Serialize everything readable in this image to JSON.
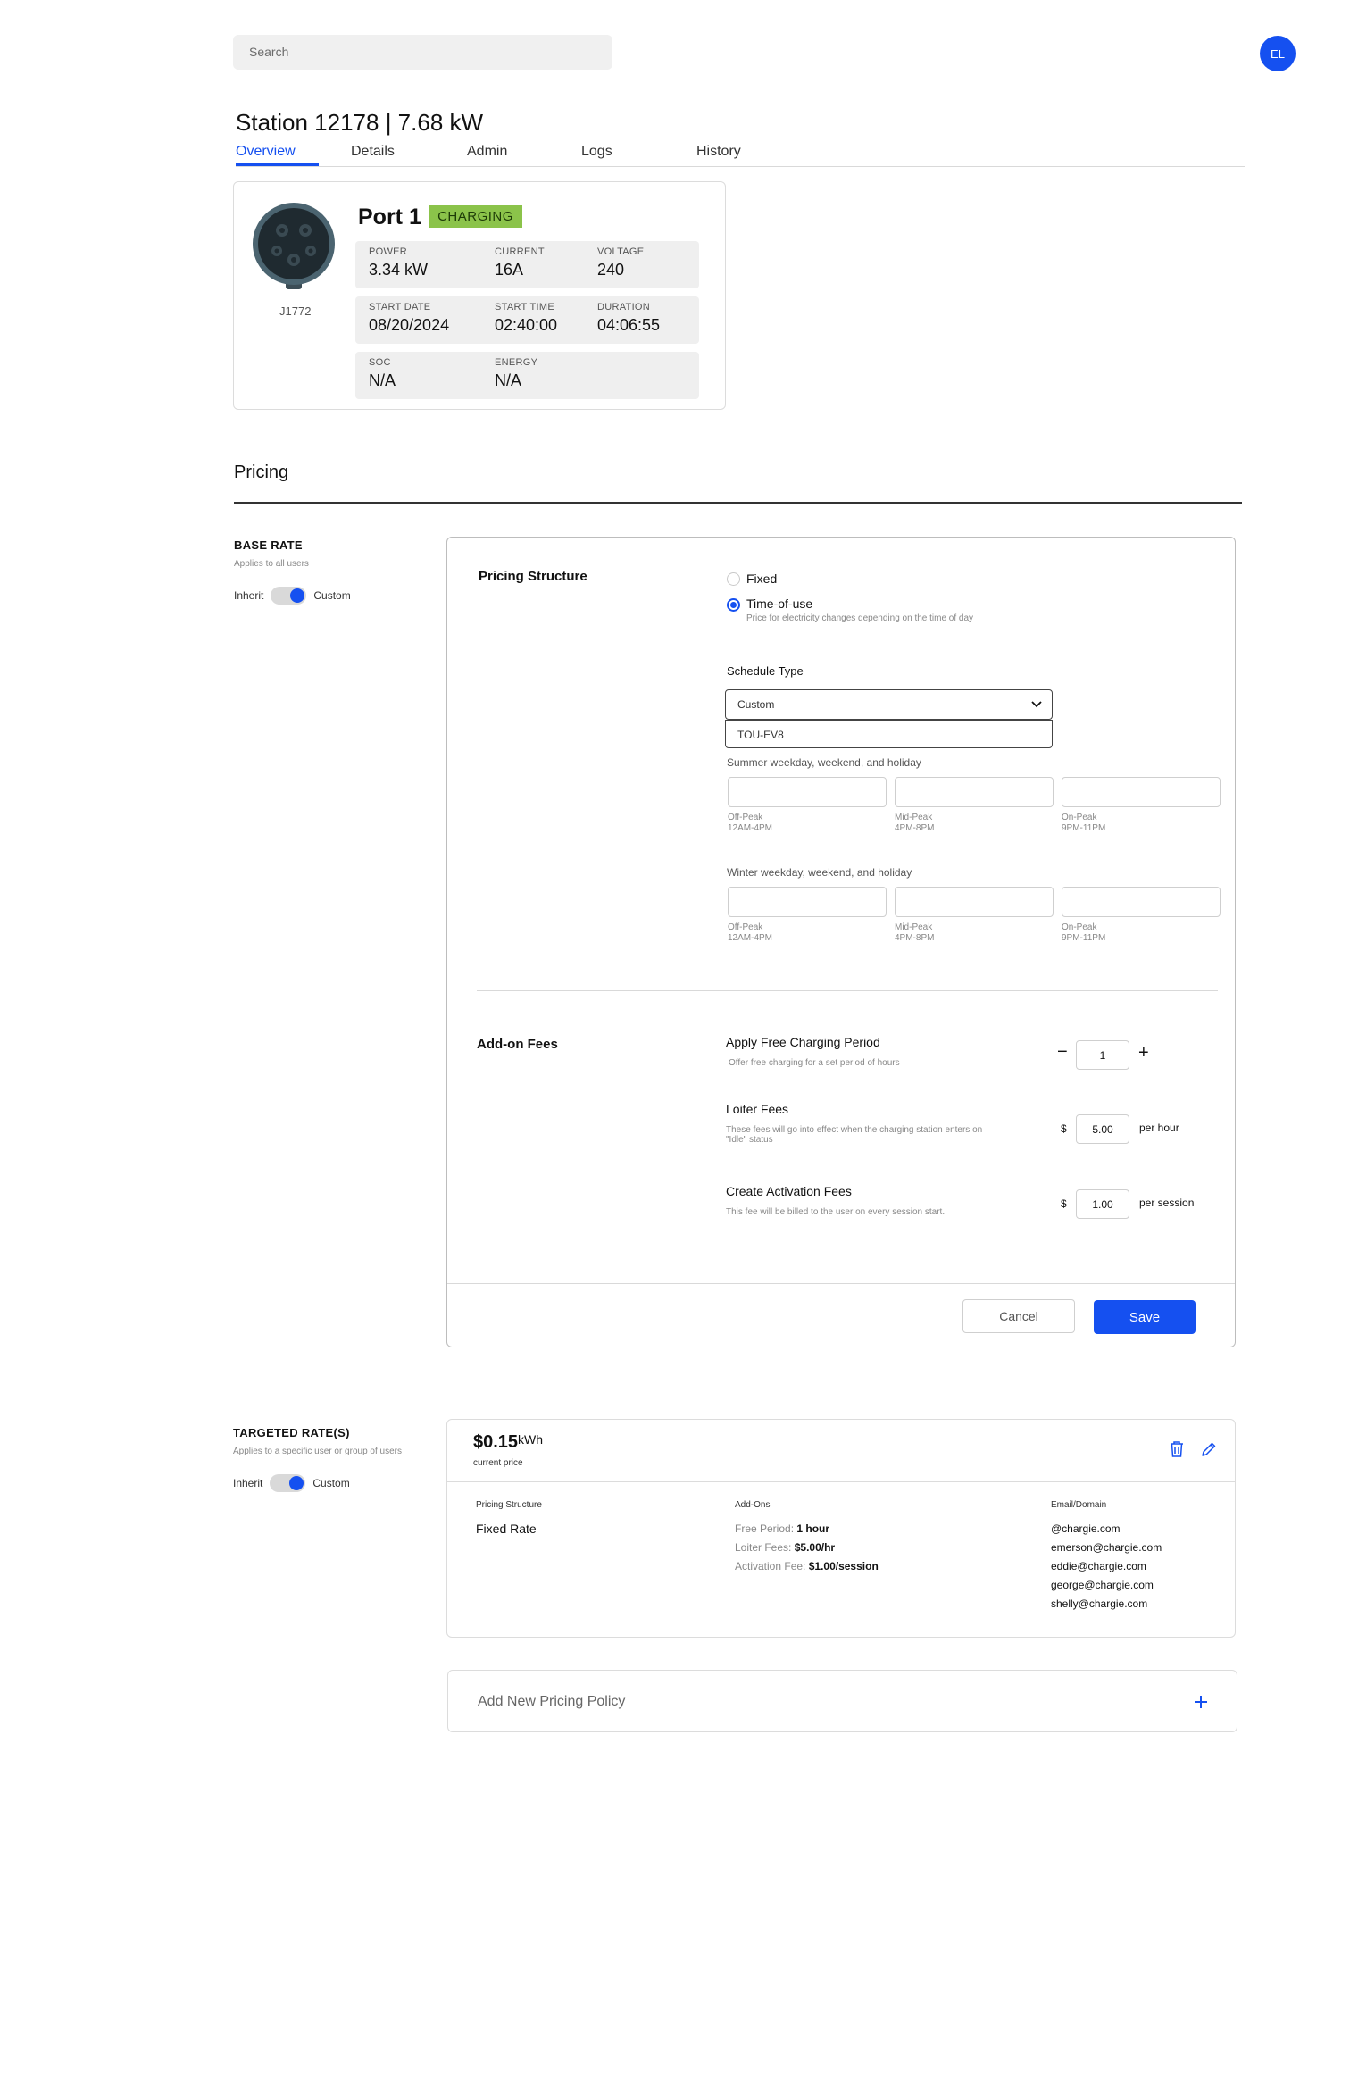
{
  "header": {
    "search_placeholder": "Search",
    "avatar_initials": "EL"
  },
  "station": {
    "title": "Station 12178 | 7.68 kW",
    "tabs": [
      "Overview",
      "Details",
      "Admin",
      "Logs",
      "History"
    ],
    "active_tab": "Overview"
  },
  "port": {
    "title": "Port 1",
    "status": "CHARGING",
    "connector": "J1772",
    "rows": [
      [
        {
          "label": "POWER",
          "value": "3.34 kW"
        },
        {
          "label": "CURRENT",
          "value": "16A"
        },
        {
          "label": "VOLTAGE",
          "value": "240"
        }
      ],
      [
        {
          "label": "START DATE",
          "value": "08/20/2024"
        },
        {
          "label": "START TIME",
          "value": "02:40:00"
        },
        {
          "label": "DURATION",
          "value": "04:06:55"
        }
      ],
      [
        {
          "label": "SOC",
          "value": "N/A"
        },
        {
          "label": "ENERGY",
          "value": "N/A"
        }
      ]
    ]
  },
  "pricing": {
    "title": "Pricing",
    "base_rate": {
      "heading": "BASE RATE",
      "sub": "Applies to all users",
      "toggle_left": "Inherit",
      "toggle_right": "Custom",
      "toggle_on": true
    },
    "structure": {
      "title": "Pricing Structure",
      "options": [
        {
          "label": "Fixed",
          "selected": false
        },
        {
          "label": "Time-of-use",
          "selected": true,
          "description": "Price for electricity changes depending on the time of day"
        }
      ],
      "schedule_label": "Schedule Type",
      "schedule_value": "Custom",
      "schedule_option": "TOU-EV8",
      "summer_label": "Summer weekday, weekend, and holiday",
      "winter_label": "Winter weekday, weekend, and holiday",
      "periods": [
        {
          "name": "Off-Peak",
          "hours": "12AM-4PM"
        },
        {
          "name": "Mid-Peak",
          "hours": "4PM-8PM"
        },
        {
          "name": "On-Peak",
          "hours": "9PM-11PM"
        }
      ]
    },
    "addons": {
      "title": "Add-on Fees",
      "free_period": {
        "title": "Apply Free Charging Period",
        "sub": "Offer free charging for a set period of hours",
        "value": "1",
        "minus": "−",
        "plus": "+"
      },
      "loiter": {
        "title": "Loiter Fees",
        "sub": "These fees will go into effect when the charging station enters on \"Idle\" status",
        "currency": "$",
        "value": "5.00",
        "unit": "per hour"
      },
      "activation": {
        "title": "Create Activation Fees",
        "sub": "This fee will be billed to the user on every session start.",
        "currency": "$",
        "value": "1.00",
        "unit": "per session"
      }
    },
    "actions": {
      "cancel": "Cancel",
      "save": "Save"
    }
  },
  "targeted": {
    "heading": "TARGETED RATE(S)",
    "sub": "Applies to a specific user or group of users",
    "toggle_left": "Inherit",
    "toggle_right": "Custom",
    "toggle_on": true,
    "price": "$0.15",
    "price_unit": "kWh",
    "price_sub": "current price",
    "structure_head": "Pricing Structure",
    "structure_value": "Fixed Rate",
    "addons_head": "Add-Ons",
    "addons": [
      {
        "label": "Free Period:",
        "value": "1 hour"
      },
      {
        "label": "Loiter Fees:",
        "value": "$5.00/hr"
      },
      {
        "label": "Activation Fee:",
        "value": "$1.00/session"
      }
    ],
    "emails_head": "Email/Domain",
    "emails": [
      "@chargie.com",
      "emerson@chargie.com",
      "eddie@chargie.com",
      "george@chargie.com",
      "shelly@chargie.com"
    ]
  },
  "add_policy": {
    "label": "Add New Pricing Policy",
    "icon": "plus-icon"
  },
  "colors": {
    "accent": "#1550f0",
    "status_charging": "#8bc34a"
  }
}
